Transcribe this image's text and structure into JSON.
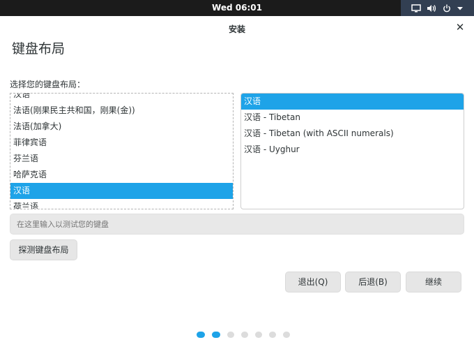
{
  "topbar": {
    "clock": "Wed 06:01",
    "icons": [
      "display-icon",
      "volume-icon",
      "power-icon",
      "chevron-down-icon"
    ]
  },
  "window": {
    "title": "安装",
    "close_glyph": "✕"
  },
  "page": {
    "heading": "键盘布局",
    "subtitle": "选择您的键盘布局："
  },
  "layouts": {
    "partial_item": "汉语",
    "items": [
      "法语(刚果民主共和国，刚果(金))",
      "法语(加拿大)",
      "菲律宾语",
      "芬兰语",
      "哈萨克语",
      "汉语",
      "荷兰语"
    ],
    "selected_index": 5
  },
  "variants": {
    "items": [
      "汉语",
      "汉语 - Tibetan",
      "汉语 - Tibetan (with ASCII numerals)",
      "汉语 - Uyghur"
    ],
    "selected_index": 0
  },
  "test_input": {
    "placeholder": "在这里输入以测试您的键盘",
    "value": ""
  },
  "buttons": {
    "detect": "探测键盘布局",
    "quit": "退出(Q)",
    "back": "后退(B)",
    "next": "继续"
  },
  "progress": {
    "total_steps": 7,
    "completed_steps": 2
  },
  "colors": {
    "accent": "#1ea3e8",
    "topbar": "#1b1b1b",
    "tray": "#323f52"
  }
}
